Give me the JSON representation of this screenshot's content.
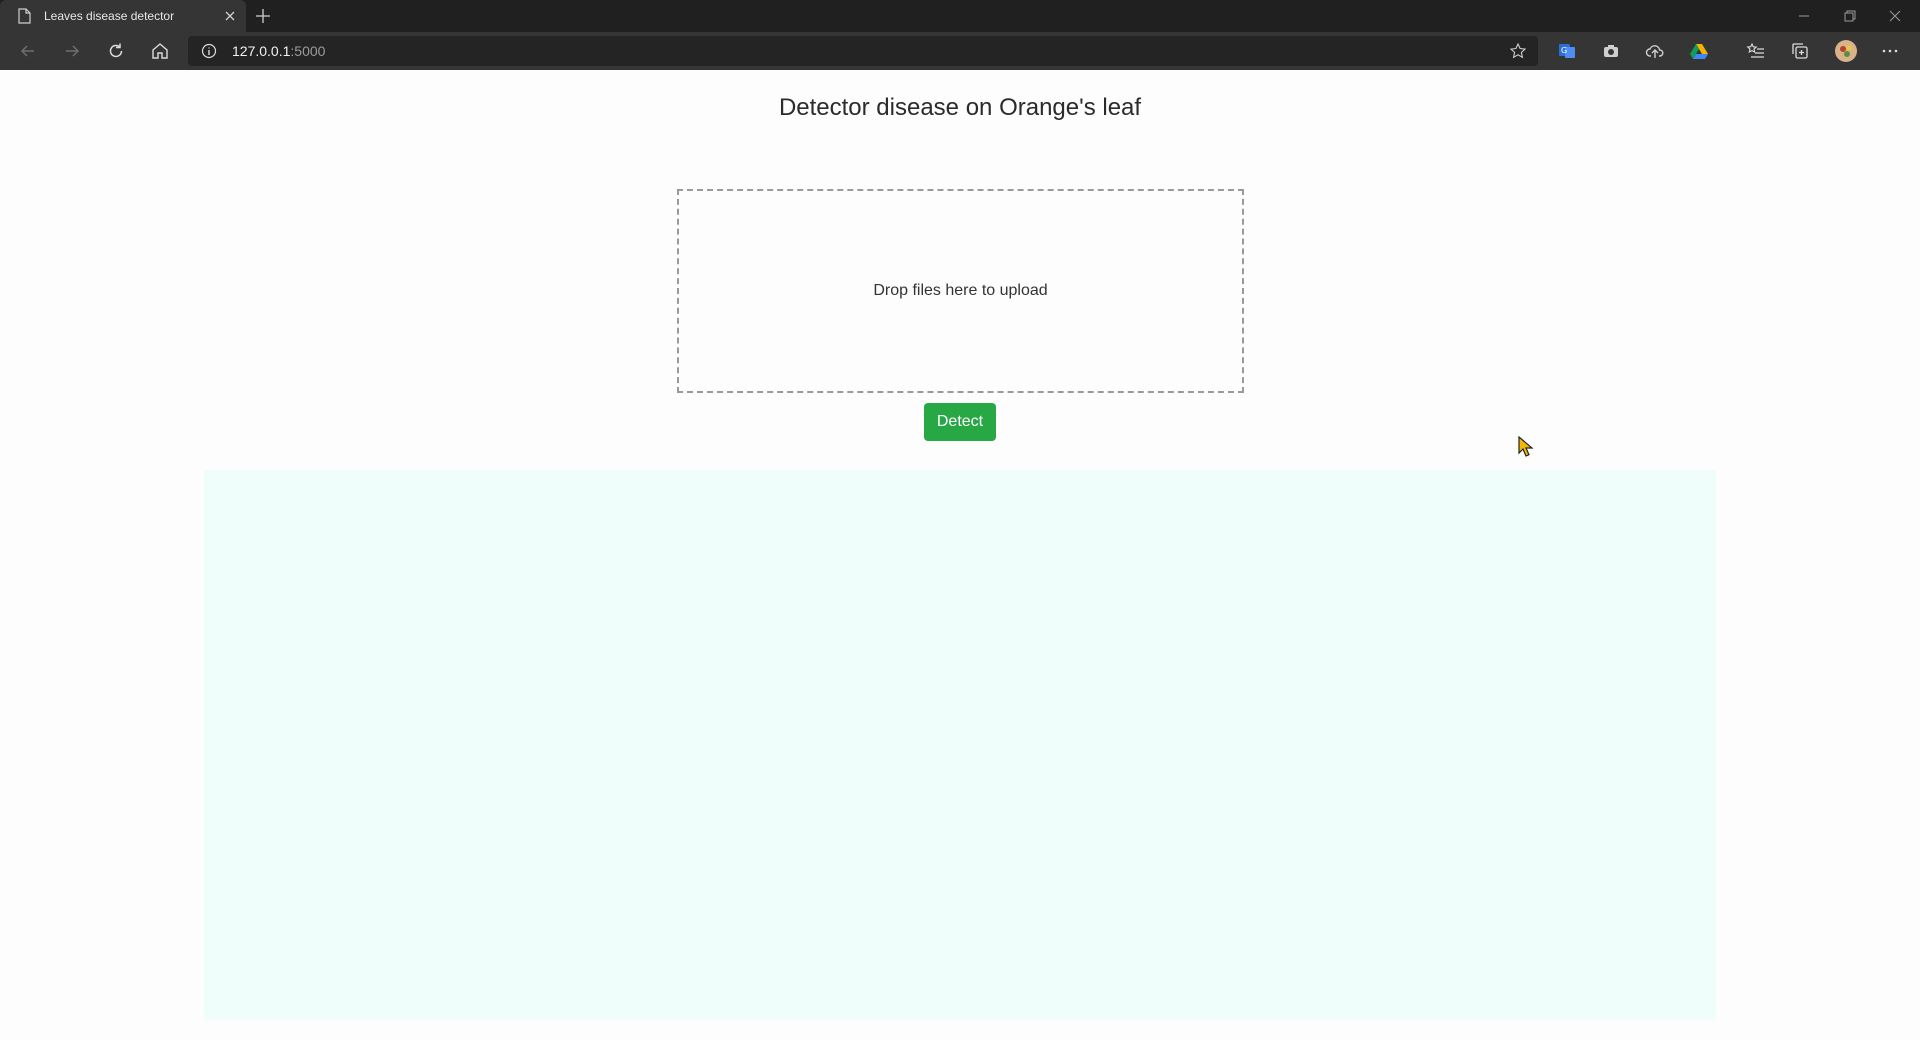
{
  "browser": {
    "tab_title": "Leaves disease detector",
    "url_host": "127.0.0.1",
    "url_port": ":5000"
  },
  "page": {
    "title": "Detector disease on Orange's leaf",
    "dropzone_text": "Drop files here to upload",
    "detect_label": "Detect"
  },
  "colors": {
    "detect_button": "#28a745",
    "result_area": "#effefb"
  }
}
